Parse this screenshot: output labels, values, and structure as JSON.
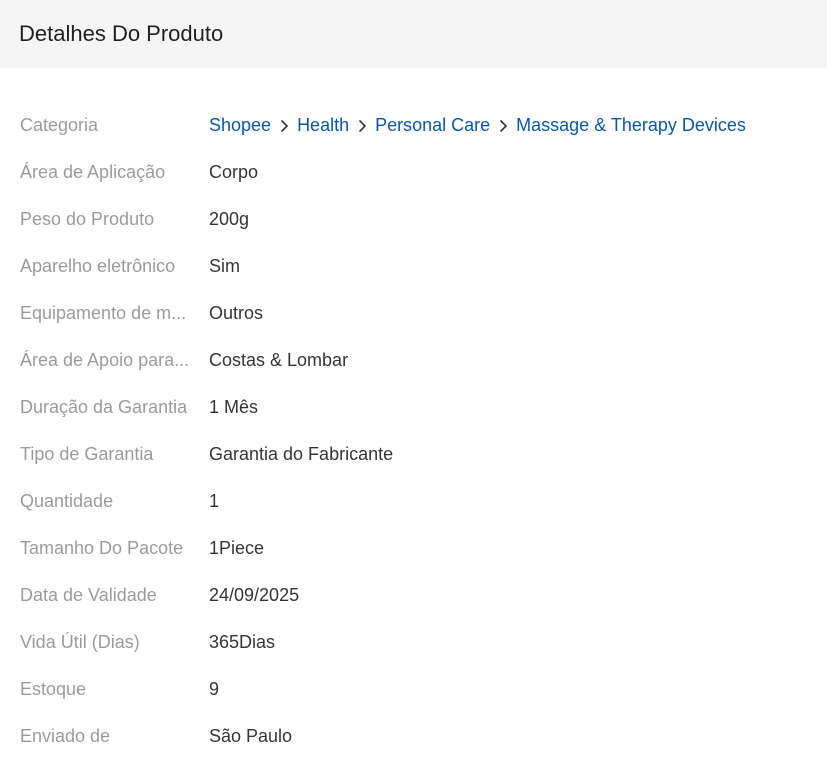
{
  "header": {
    "title": "Detalhes Do Produto"
  },
  "colors": {
    "header_bg": "#f5f5f5",
    "link": "#0b57a4",
    "label": "#999999",
    "value": "#333333"
  },
  "category": {
    "label": "Categoria",
    "breadcrumb": [
      "Shopee",
      "Health",
      "Personal Care",
      "Massage & Therapy Devices"
    ]
  },
  "attributes": [
    {
      "label": "Área de Aplicação",
      "value": "Corpo"
    },
    {
      "label": "Peso do Produto",
      "value": "200g"
    },
    {
      "label": "Aparelho eletrônico",
      "value": "Sim"
    },
    {
      "label": "Equipamento de m...",
      "value": "Outros"
    },
    {
      "label": "Área de Apoio para...",
      "value": "Costas & Lombar"
    },
    {
      "label": "Duração da Garantia",
      "value": "1 Mês"
    },
    {
      "label": "Tipo de Garantia",
      "value": "Garantia do Fabricante"
    },
    {
      "label": "Quantidade",
      "value": "1"
    },
    {
      "label": "Tamanho Do Pacote",
      "value": "1Piece"
    },
    {
      "label": "Data de Validade",
      "value": "24/09/2025"
    },
    {
      "label": "Vida Útil (Dias)",
      "value": "365Dias"
    },
    {
      "label": "Estoque",
      "value": "9"
    },
    {
      "label": "Enviado de",
      "value": "São Paulo"
    }
  ]
}
